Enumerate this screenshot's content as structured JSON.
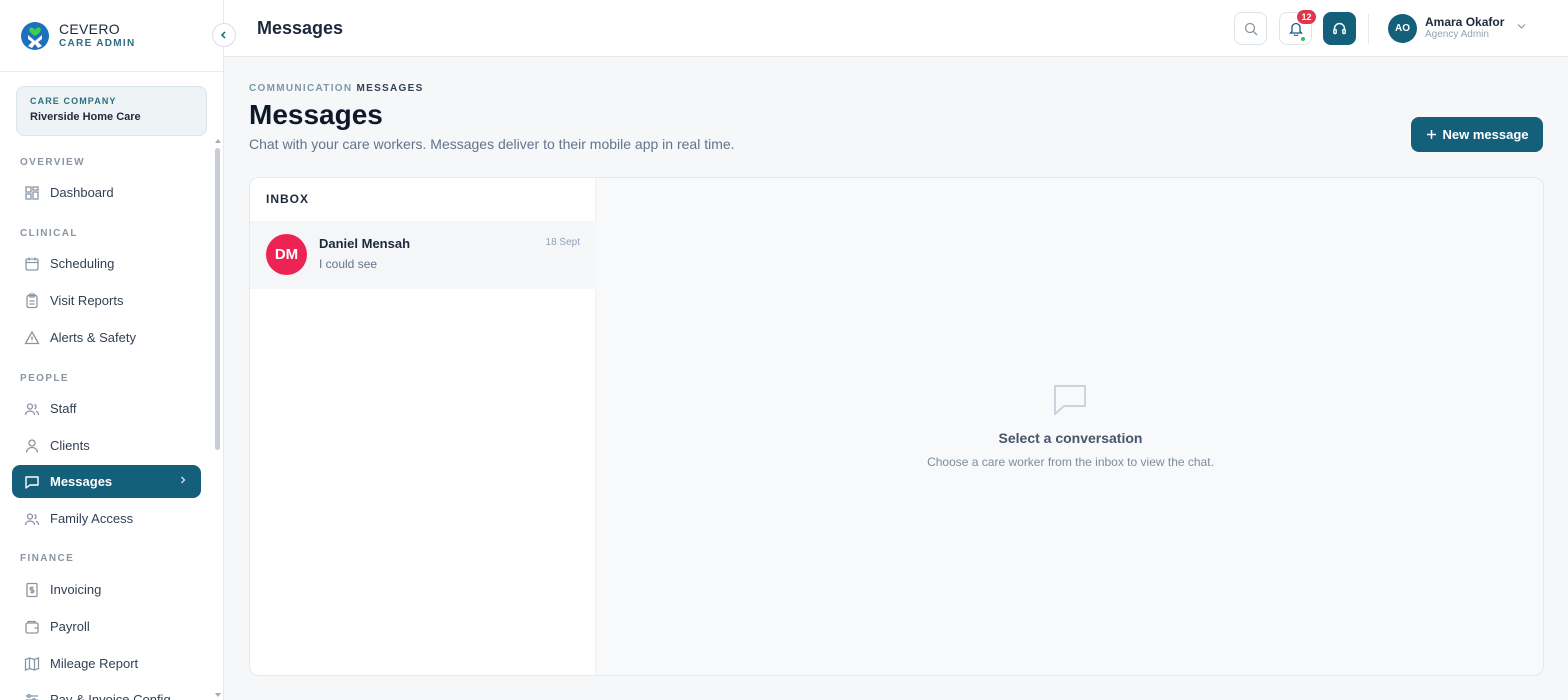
{
  "brand": {
    "name": "CEVERO",
    "subtitle": "CARE ADMIN"
  },
  "company": {
    "label": "CARE COMPANY",
    "name": "Riverside Home Care"
  },
  "sidebar": {
    "sections": [
      {
        "title": "OVERVIEW"
      },
      {
        "title": "CLINICAL"
      },
      {
        "title": "PEOPLE"
      },
      {
        "title": "FINANCE"
      }
    ],
    "items": [
      {
        "label": "Dashboard",
        "icon": "dashboard-icon"
      },
      {
        "label": "Scheduling",
        "icon": "calendar-icon"
      },
      {
        "label": "Visit Reports",
        "icon": "clipboard-icon"
      },
      {
        "label": "Alerts & Safety",
        "icon": "warning-icon"
      },
      {
        "label": "Staff",
        "icon": "users-icon"
      },
      {
        "label": "Clients",
        "icon": "user-icon"
      },
      {
        "label": "Messages",
        "icon": "chat-icon",
        "active": true
      },
      {
        "label": "Family Access",
        "icon": "users-icon"
      },
      {
        "label": "Invoicing",
        "icon": "invoice-icon"
      },
      {
        "label": "Payroll",
        "icon": "wallet-icon"
      },
      {
        "label": "Mileage Report",
        "icon": "map-icon"
      },
      {
        "label": "Pay & Invoice Config",
        "icon": "sliders-icon"
      }
    ]
  },
  "header": {
    "title": "Messages",
    "notification_count": "12",
    "user": {
      "initials": "AO",
      "name": "Amara Okafor",
      "role": "Agency Admin"
    }
  },
  "page": {
    "breadcrumb": {
      "parent": "COMMUNICATION",
      "current": "MESSAGES"
    },
    "title": "Messages",
    "subtitle": "Chat with your care workers. Messages deliver to their mobile app in real time.",
    "new_button": "New message"
  },
  "inbox": {
    "title": "INBOX",
    "conversations": [
      {
        "initials": "DM",
        "name": "Daniel Mensah",
        "preview": "I could see",
        "date": "18 Sept"
      }
    ]
  },
  "empty_state": {
    "title": "Select a conversation",
    "subtitle": "Choose a care worker from the inbox to view the chat."
  },
  "colors": {
    "primary": "#145f7a",
    "badge": "#e0354b",
    "avatar_dm": "#ec2354",
    "online": "#22c55e"
  }
}
